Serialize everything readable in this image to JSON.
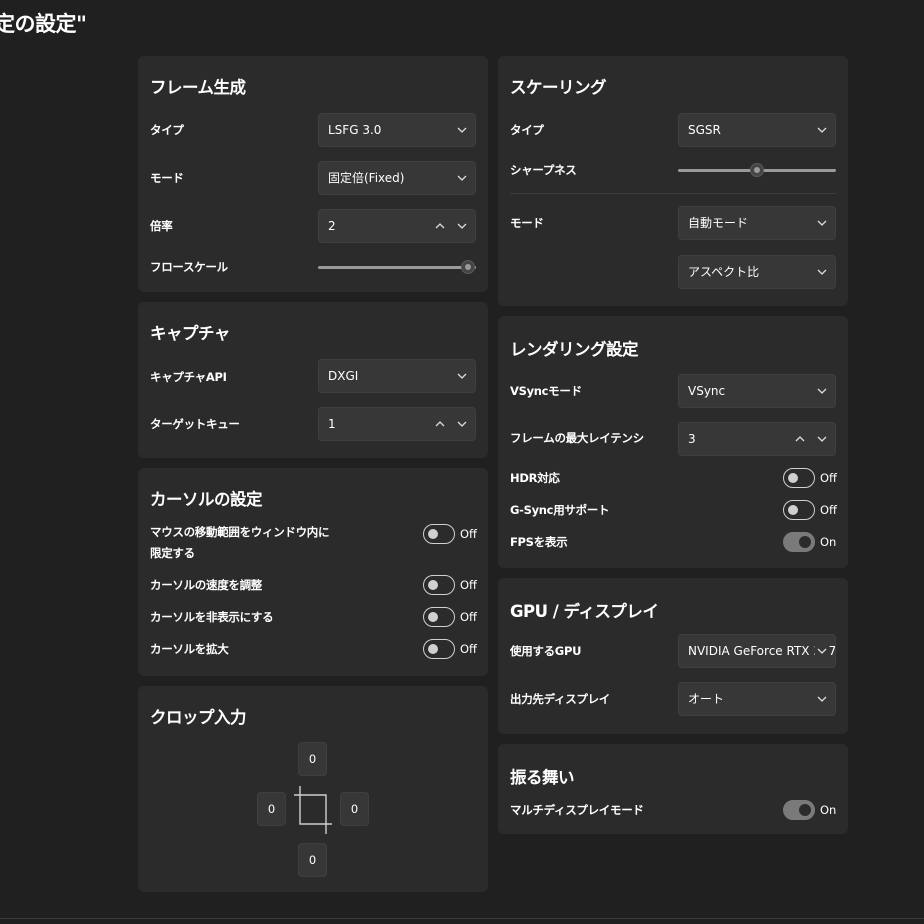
{
  "page_title": "定の設定\"",
  "frame_gen": {
    "title": "フレーム生成",
    "type_label": "タイプ",
    "type_value": "LSFG 3.0",
    "mode_label": "モード",
    "mode_value": "固定倍(Fixed)",
    "multiplier_label": "倍率",
    "multiplier_value": "2",
    "flow_scale_label": "フロースケール",
    "flow_scale_level": 0.95
  },
  "capture": {
    "title": "キャプチャ",
    "api_label": "キャプチャAPI",
    "api_value": "DXGI",
    "queue_label": "ターゲットキュー",
    "queue_value": "1"
  },
  "cursor": {
    "title": "カーソルの設定",
    "items": [
      {
        "label": "マウスの移動範囲をウィンドウ内に限定する",
        "state": "Off"
      },
      {
        "label": "カーソルの速度を調整",
        "state": "Off"
      },
      {
        "label": "カーソルを非表示にする",
        "state": "Off"
      },
      {
        "label": "カーソルを拡大",
        "state": "Off"
      }
    ]
  },
  "crop": {
    "title": "クロップ入力",
    "top": "0",
    "left": "0",
    "right": "0",
    "bottom": "0"
  },
  "scaling": {
    "title": "スケーリング",
    "type_label": "タイプ",
    "type_value": "SGSR",
    "sharpness_label": "シャープネス",
    "sharpness_level": 0.5,
    "mode_label": "モード",
    "mode_value": "自動モード",
    "aspect_value": "アスペクト比"
  },
  "rendering": {
    "title": "レンダリング設定",
    "vsync_label": "VSyncモード",
    "vsync_value": "VSync",
    "latency_label": "フレームの最大レイテンシ",
    "latency_value": "3",
    "hdr_label": "HDR対応",
    "hdr_state": "Off",
    "gsync_label": "G-Sync用サポート",
    "gsync_state": "Off",
    "fps_label": "FPSを表示",
    "fps_state": "On"
  },
  "gpu": {
    "title": "GPU / ディスプレイ",
    "gpu_label": "使用するGPU",
    "gpu_value": "NVIDIA GeForce RTX 307",
    "display_label": "出力先ディスプレイ",
    "display_value": "オート"
  },
  "behavior": {
    "title": "振る舞い",
    "multi_display_label": "マルチディスプレイモード",
    "multi_display_state": "On"
  }
}
